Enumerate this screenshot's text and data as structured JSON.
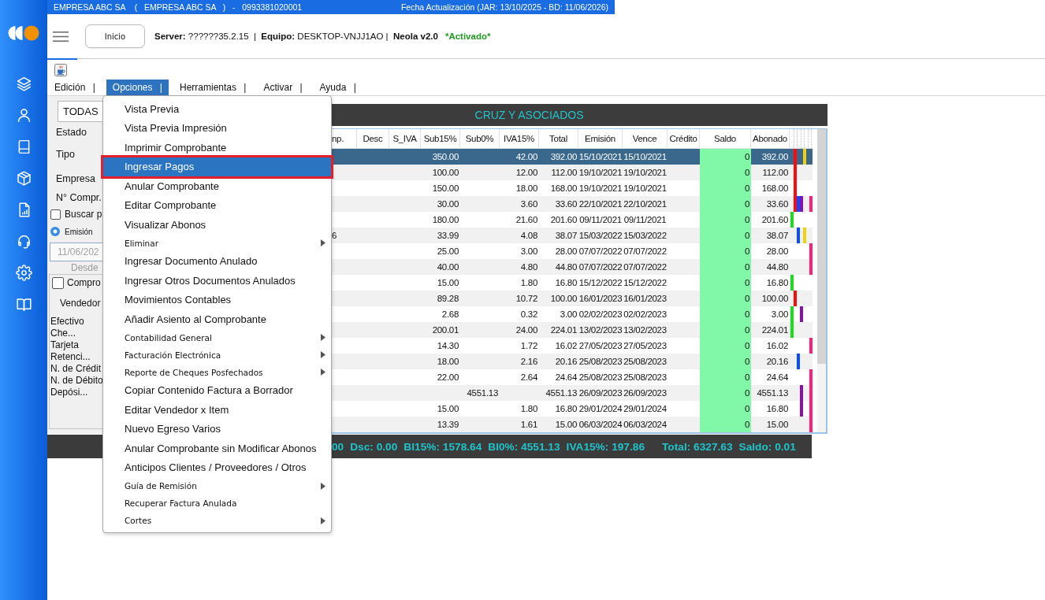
{
  "top_bar": {
    "company": "EMPRESA ABC SA    (   EMPRESA ABC SA   )   -   0993381020001",
    "update_info": "Fecha Actualización (JAR: 13/10/2025 - BD: 11/06/2026)"
  },
  "header": {
    "home_button": "Inicio",
    "status_line": "**Server:** ??????35.2.15  |  **Equipo:** DESKTOP-VNJJ1AO |  **Neola v2.0**",
    "activation": "*Activado*"
  },
  "menu_bar": {
    "items": [
      {
        "label": "Edición |",
        "selected": false
      },
      {
        "label": "Opciones |",
        "selected": true
      },
      {
        "label": "Herramientas |",
        "selected": false
      },
      {
        "label": "Activar |",
        "selected": false
      },
      {
        "label": "Ayuda |",
        "selected": false
      }
    ]
  },
  "filter_panel": {
    "scope_select": "TODAS",
    "labels": [
      "Estado",
      "Tipo",
      "Empresa",
      "N° Compr."
    ],
    "search_option": {
      "label": "Buscar p",
      "checked": false
    },
    "date_mode": {
      "label": "Emisión",
      "selected": true
    },
    "date_field": {
      "value": "11/06/202",
      "disabled": true
    },
    "date_caption": "Desde",
    "voucher_option": {
      "label": "Compro",
      "checked": false
    },
    "seller_label": "Vendedor",
    "payment_types": [
      "Efectivo",
      "Che...",
      "Tarjeta",
      "Retenci...",
      "N. de Crédit",
      "N. de Débito",
      "Depósi..."
    ]
  },
  "options_menu": {
    "items": [
      {
        "label": "Vista Previa",
        "kind": "standard",
        "submenu": false,
        "selected": false,
        "outlined": false
      },
      {
        "label": "Vista Previa Impresión",
        "kind": "standard",
        "submenu": false,
        "selected": false,
        "outlined": false
      },
      {
        "label": "Imprimir Comprobante",
        "kind": "standard",
        "submenu": false,
        "selected": false,
        "outlined": false
      },
      {
        "label": "Ingresar Pagos",
        "kind": "standard",
        "submenu": false,
        "selected": true,
        "outlined": true
      },
      {
        "label": "Anular Comprobante",
        "kind": "standard",
        "submenu": false,
        "selected": false,
        "outlined": false
      },
      {
        "label": "Editar Comprobante",
        "kind": "standard",
        "submenu": false,
        "selected": false,
        "outlined": false
      },
      {
        "label": "Visualizar Abonos",
        "kind": "standard",
        "submenu": false,
        "selected": false,
        "outlined": false
      },
      {
        "label": "Eliminar",
        "kind": "compact",
        "submenu": true,
        "selected": false,
        "outlined": false
      },
      {
        "label": "Ingresar Documento Anulado",
        "kind": "standard",
        "submenu": false,
        "selected": false,
        "outlined": false
      },
      {
        "label": "Ingresar Otros Documentos Anulados",
        "kind": "standard",
        "submenu": false,
        "selected": false,
        "outlined": false
      },
      {
        "label": "Movimientos Contables",
        "kind": "standard",
        "submenu": false,
        "selected": false,
        "outlined": false
      },
      {
        "label": "Añadir Asiento al Comprobante",
        "kind": "standard",
        "submenu": false,
        "selected": false,
        "outlined": false
      },
      {
        "label": "Contabilidad General",
        "kind": "compact",
        "submenu": true,
        "selected": false,
        "outlined": false
      },
      {
        "label": "Facturación Electrónica",
        "kind": "compact",
        "submenu": true,
        "selected": false,
        "outlined": false
      },
      {
        "label": "Reporte de Cheques Posfechados",
        "kind": "compact",
        "submenu": true,
        "selected": false,
        "outlined": false
      },
      {
        "label": "Copiar Contenido Factura a Borrador",
        "kind": "standard",
        "submenu": false,
        "selected": false,
        "outlined": false
      },
      {
        "label": "Editar Vendedor x Item",
        "kind": "standard",
        "submenu": false,
        "selected": false,
        "outlined": false
      },
      {
        "label": "Nuevo Egreso Varios",
        "kind": "standard",
        "submenu": false,
        "selected": false,
        "outlined": false
      },
      {
        "label": "Anular Comprobante sin Modificar Abonos",
        "kind": "standard",
        "submenu": false,
        "selected": false,
        "outlined": false
      },
      {
        "label": "Anticipos Clientes / Proveedores / Otros",
        "kind": "standard",
        "submenu": false,
        "selected": false,
        "outlined": false
      },
      {
        "label": "Guía de Remisión",
        "kind": "compact",
        "submenu": true,
        "selected": false,
        "outlined": false
      },
      {
        "label": "Recuperar Factura Anulada",
        "kind": "compact",
        "submenu": false,
        "selected": false,
        "outlined": false
      },
      {
        "label": "Cortes",
        "kind": "compact",
        "submenu": true,
        "selected": false,
        "outlined": false
      }
    ]
  },
  "table": {
    "title": "CRUZ Y ASOCIADOS",
    "columns": [
      "np.",
      "Desc",
      "S_IVA",
      "Sub15%",
      "Sub0%",
      "IVA15%",
      "Total",
      "Emisión",
      "Vence",
      "Crédito",
      "Saldo",
      "Abonado"
    ],
    "marker_columns": [
      {
        "color": "#16e016"
      },
      {
        "color": "#ff0a0a"
      },
      {
        "color": "#0a4cff"
      },
      {
        "color": "#8b0fb0"
      },
      {
        "color": "#f2d20c"
      },
      {
        "color": "#ff1f7a"
      }
    ],
    "rows": [
      {
        "selected": true,
        "sub15": "350.00",
        "iva15": "42.00",
        "total": "392.00",
        "emision": "15/10/2021",
        "vence": "15/10/2021",
        "saldo": "0",
        "abonado": "392.00",
        "markers": [
          false,
          true,
          false,
          false,
          true,
          false
        ]
      },
      {
        "selected": false,
        "sub15": "100.00",
        "iva15": "12.00",
        "total": "112.00",
        "emision": "19/10/2021",
        "vence": "19/10/2021",
        "saldo": "0",
        "abonado": "112.00",
        "markers": [
          false,
          true,
          false,
          false,
          false,
          false
        ]
      },
      {
        "selected": false,
        "sub15": "150.00",
        "iva15": "18.00",
        "total": "168.00",
        "emision": "19/10/2021",
        "vence": "19/10/2021",
        "saldo": "0",
        "abonado": "168.00",
        "markers": [
          false,
          true,
          false,
          false,
          false,
          false
        ]
      },
      {
        "selected": false,
        "sub15": "30.00",
        "iva15": "3.60",
        "total": "33.60",
        "emision": "22/10/2021",
        "vence": "22/10/2021",
        "saldo": "0",
        "abonado": "33.60",
        "markers": [
          false,
          true,
          true,
          true,
          false,
          true
        ]
      },
      {
        "selected": false,
        "sub15": "180.00",
        "iva15": "21.60",
        "total": "201.60",
        "emision": "09/11/2021",
        "vence": "09/11/2021",
        "saldo": "0",
        "abonado": "201.60",
        "markers": [
          true,
          false,
          false,
          false,
          false,
          false
        ]
      },
      {
        "selected": false,
        "column_1": "6",
        "sub15": "33.99",
        "iva15": "4.08",
        "total": "38.07",
        "emision": "15/03/2022",
        "vence": "15/03/2022",
        "saldo": "0",
        "abonado": "38.07",
        "markers": [
          false,
          false,
          true,
          false,
          true,
          false
        ]
      },
      {
        "selected": false,
        "sub15": "25.00",
        "iva15": "3.00",
        "total": "28.00",
        "emision": "07/07/2022",
        "vence": "07/07/2022",
        "saldo": "0",
        "abonado": "28.00",
        "markers": [
          false,
          false,
          false,
          false,
          false,
          true
        ]
      },
      {
        "selected": false,
        "sub15": "40.00",
        "iva15": "4.80",
        "total": "44.80",
        "emision": "07/07/2022",
        "vence": "07/07/2022",
        "saldo": "0",
        "abonado": "44.80",
        "markers": [
          false,
          false,
          false,
          false,
          false,
          true
        ]
      },
      {
        "selected": false,
        "sub15": "15.00",
        "iva15": "1.80",
        "total": "16.80",
        "emision": "15/12/2022",
        "vence": "15/12/2022",
        "saldo": "0",
        "abonado": "16.80",
        "markers": [
          true,
          false,
          false,
          false,
          false,
          false
        ]
      },
      {
        "selected": false,
        "sub15": "89.28",
        "iva15": "10.72",
        "total": "100.00",
        "emision": "16/01/2023",
        "vence": "16/01/2023",
        "saldo": "0",
        "abonado": "100.00",
        "markers": [
          false,
          true,
          false,
          false,
          false,
          false
        ]
      },
      {
        "selected": false,
        "sub15": "2.68",
        "iva15": "0.32",
        "total": "3.00",
        "emision": "02/02/2023",
        "vence": "02/02/2023",
        "saldo": "0",
        "abonado": "3.00",
        "markers": [
          true,
          false,
          false,
          true,
          false,
          false
        ]
      },
      {
        "selected": false,
        "sub15": "200.01",
        "iva15": "24.00",
        "total": "224.01",
        "emision": "13/02/2023",
        "vence": "13/02/2023",
        "saldo": "0",
        "abonado": "224.01",
        "markers": [
          true,
          false,
          false,
          false,
          false,
          false
        ]
      },
      {
        "selected": false,
        "sub15": "14.30",
        "iva15": "1.72",
        "total": "16.02",
        "emision": "27/05/2023",
        "vence": "27/05/2023",
        "saldo": "0",
        "abonado": "16.02",
        "markers": [
          false,
          false,
          false,
          false,
          false,
          true
        ]
      },
      {
        "selected": false,
        "sub15": "18.00",
        "iva15": "2.16",
        "total": "20.16",
        "emision": "25/08/2023",
        "vence": "25/08/2023",
        "saldo": "0",
        "abonado": "20.16",
        "markers": [
          false,
          false,
          true,
          false,
          false,
          false
        ]
      },
      {
        "selected": false,
        "sub15": "22.00",
        "iva15": "2.64",
        "total": "24.64",
        "emision": "25/08/2023",
        "vence": "25/08/2023",
        "saldo": "0",
        "abonado": "24.64",
        "markers": [
          false,
          false,
          false,
          false,
          false,
          true
        ]
      },
      {
        "selected": false,
        "sub0": "4551.13",
        "total": "4551.13",
        "emision": "26/09/2023",
        "vence": "26/09/2023",
        "saldo": "0",
        "abonado": "4551.13",
        "markers": [
          false,
          false,
          false,
          true,
          false,
          true
        ]
      },
      {
        "selected": false,
        "sub15": "15.00",
        "iva15": "1.80",
        "total": "16.80",
        "emision": "29/01/2024",
        "vence": "29/01/2024",
        "saldo": "0",
        "abonado": "16.80",
        "markers": [
          false,
          false,
          false,
          true,
          false,
          true
        ]
      },
      {
        "selected": false,
        "sub15": "13.39",
        "iva15": "1.61",
        "total": "15.00",
        "emision": "06/03/2024",
        "vence": "06/03/2024",
        "saldo": "0",
        "abonado": "15.00",
        "markers": [
          false,
          false,
          false,
          false,
          false,
          true
        ]
      }
    ]
  },
  "totals": [
    "00",
    "Dsc: 0.00",
    "BI15%: 1578.64",
    "BI0%: 4551.13",
    "IVA15%: 197.86",
    "Total: 6327.63",
    "Saldo: 0.01"
  ]
}
